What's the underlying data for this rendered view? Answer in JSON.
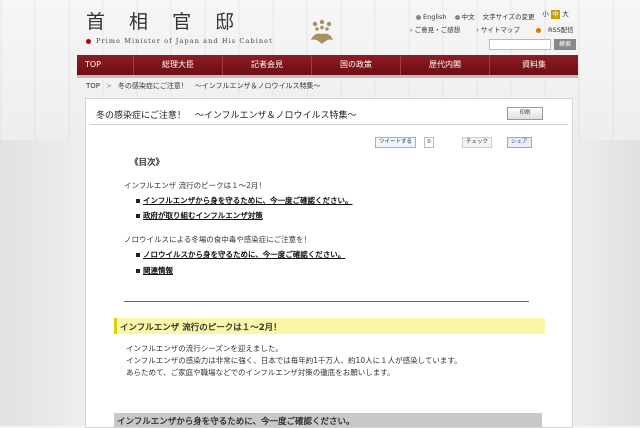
{
  "header": {
    "logo_jp": "首 相 官 邸",
    "logo_en": "Prime Minister of Japan and His Cabinet",
    "utility": [
      "English",
      "中文",
      "文字サイズの変更"
    ],
    "font_sizes": [
      "小",
      "中",
      "大"
    ],
    "links": [
      "ご意見・ご感想",
      "サイトマップ",
      "RSS配信"
    ],
    "search_button": "検索"
  },
  "nav": {
    "items": [
      "TOP",
      "総理大臣",
      "記者会見",
      "国の政策",
      "歴代内閣",
      "資料集"
    ]
  },
  "breadcrumb": {
    "home": "TOP",
    "sep": ">",
    "current": "冬の感染症にご注意！　～インフルエンザ＆ノロウイルス特集～"
  },
  "page": {
    "title": "冬の感染症にご注意！　～インフルエンザ＆ノロウイルス特集～",
    "print_label": "印刷",
    "tweet_label": "ツイートする",
    "tweet_count": "0",
    "check_label": "チェック",
    "share_label": "シェア"
  },
  "toc": {
    "title": "《目次》",
    "group1_text": "インフルエンザ 流行のピークは１～2月！",
    "group1_links": [
      "インフルエンザから身を守るために、今一度ご確認ください。",
      "政府が取り組むインフルエンザ対策"
    ],
    "group2_text": "ノロウイルスによる冬場の食中毒や感染症にご注意を！",
    "group2_links": [
      "ノロウイルスから身を守るために、今一度ご確認ください。",
      "関連情報"
    ]
  },
  "section1": {
    "heading": "インフルエンザ 流行のピークは１～2月！",
    "lines": [
      "インフルエンザの流行シーズンを迎えました。",
      "インフルエンザの感染力は非常に強く、日本では毎年約1千万人、約10人に１人が感染しています。",
      "あらためて、ご家庭や職場などでのインフルエンザ対策の徹底をお願いします。"
    ]
  },
  "section2": {
    "heading": "インフルエンザから身を守るために、今一度ご確認ください。"
  }
}
